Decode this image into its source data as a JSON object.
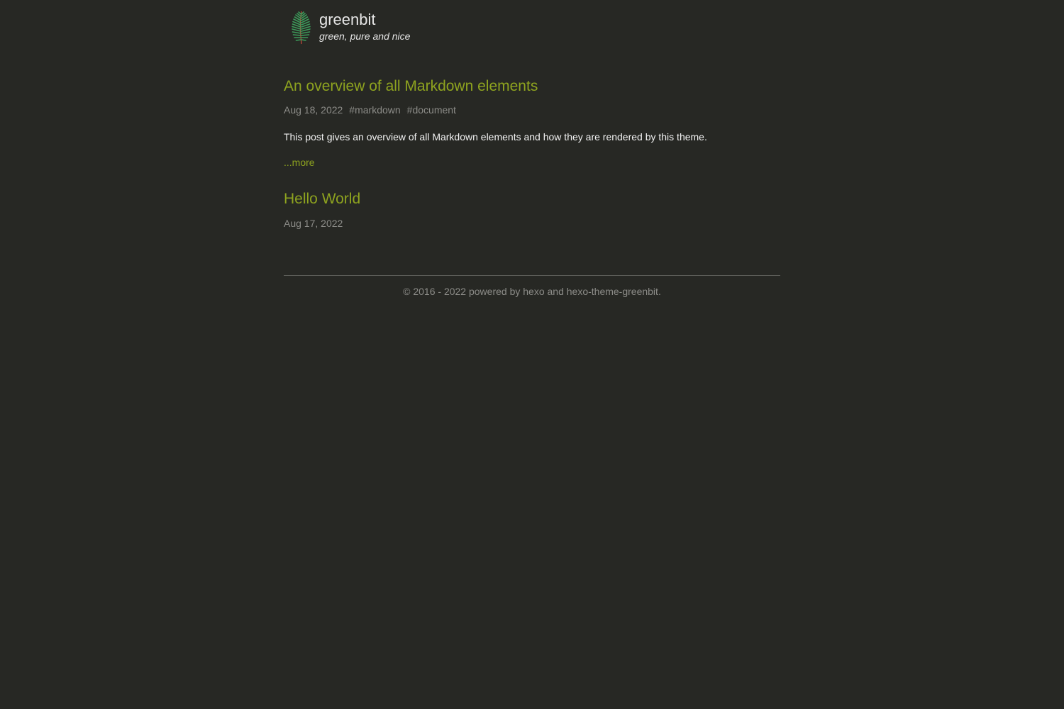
{
  "site": {
    "title": "greenbit",
    "subtitle": "green, pure and nice",
    "logo_icon": "palm-leaf-icon"
  },
  "posts": [
    {
      "title": "An overview of all Markdown elements",
      "date": "Aug 18, 2022",
      "tags": [
        "#markdown",
        "#document"
      ],
      "excerpt": "This post gives an overview of all Markdown elements and how they are rendered by this theme.",
      "more_label": "...more"
    },
    {
      "title": "Hello World",
      "date": "Aug 17, 2022"
    }
  ],
  "footer": {
    "prefix": "© 2016 - 2022 powered by ",
    "link_hexo": "hexo",
    "and": " and ",
    "link_theme": "hexo-theme-greenbit",
    "suffix": "."
  },
  "colors": {
    "background": "#272824",
    "accent": "#8ea31f",
    "muted": "#8c8c88",
    "text": "#f2f2f2"
  }
}
